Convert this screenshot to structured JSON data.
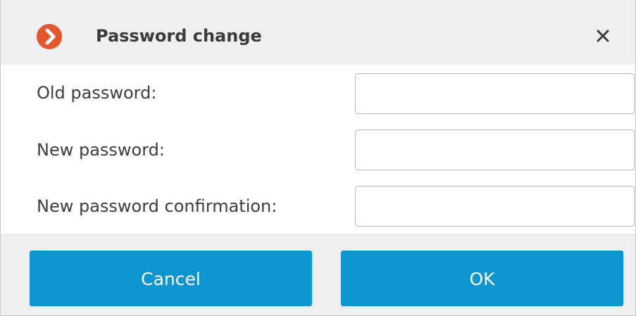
{
  "dialog": {
    "title": "Password change",
    "logo_icon": "chevron-right-circle-icon",
    "close_icon": "close-icon"
  },
  "form": {
    "old_password_label": "Old password:",
    "new_password_label": "New password:",
    "confirm_password_label": "New password confirmation:",
    "old_password_value": "",
    "new_password_value": "",
    "confirm_password_value": ""
  },
  "buttons": {
    "cancel_label": "Cancel",
    "ok_label": "OK"
  },
  "colors": {
    "accent": "#0b95d1",
    "logo": "#e4572e",
    "titlebar_bg": "#efefef",
    "footer_bg": "#efefef"
  }
}
